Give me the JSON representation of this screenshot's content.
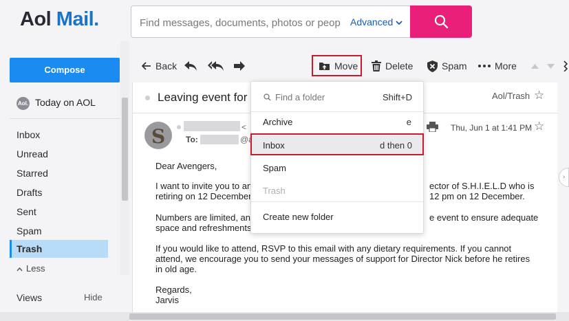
{
  "header": {
    "logo_aol": "Aol",
    "logo_mail": "Mail.",
    "search_placeholder": "Find messages, documents, photos or people",
    "advanced_label": "Advanced",
    "search_button_icon": "search-icon",
    "search_button_color": "#ea1f79"
  },
  "sidebar": {
    "compose_label": "Compose",
    "today_badge": "Aol.",
    "today_label": "Today on AOL",
    "folders": [
      {
        "label": "Inbox"
      },
      {
        "label": "Unread"
      },
      {
        "label": "Starred"
      },
      {
        "label": "Drafts"
      },
      {
        "label": "Sent"
      },
      {
        "label": "Spam"
      },
      {
        "label": "Trash",
        "active": true
      }
    ],
    "less_label": "Less",
    "views_label": "Views",
    "hide_label": "Hide",
    "accent_color": "#1a8bf0"
  },
  "toolbar": {
    "back_label": "Back",
    "move_label": "Move",
    "delete_label": "Delete",
    "spam_label": "Spam",
    "more_label": "More"
  },
  "message": {
    "subject": "Leaving event for C",
    "folder_label": "Aol/Trash",
    "from_tail": "<",
    "to_label": "To:",
    "to_tail": "@a",
    "date": "Thu, Jun 1 at 1:41 PM",
    "body": {
      "greeting": "Dear Avengers,",
      "p1_line1_left": "I want to invite you to an",
      "p1_line1_right": "ector of S.H.I.E.L.D who is",
      "p1_line2_left": "retiring on 12 December",
      "p1_line2_right": "12 pm on 12 December.",
      "p2_line1_left": "Numbers are limited, and",
      "p2_line1_right": "e event to ensure adequate",
      "p2_line2_left": "space and refreshments",
      "p3_line1": "If you would like to attend, RSVP to this email with any dietary requirements. If you cannot",
      "p3_line2": "attend, we encourage you to send your messages of support for Director Nick before he retires",
      "p3_line3": "in old age.",
      "regards": "Regards,",
      "signature": "Jarvis"
    }
  },
  "move_menu": {
    "search_placeholder": "Find a folder",
    "search_shortcut": "Shift+D",
    "items": [
      {
        "label": "Archive",
        "shortcut": "e"
      },
      {
        "label": "Inbox",
        "shortcut": "d then 0",
        "highlighted": true
      },
      {
        "label": "Spam",
        "shortcut": ""
      },
      {
        "label": "Trash",
        "shortcut": "",
        "disabled": true
      }
    ],
    "create_label": "Create new folder",
    "annotation_color": "#c71a2a"
  }
}
